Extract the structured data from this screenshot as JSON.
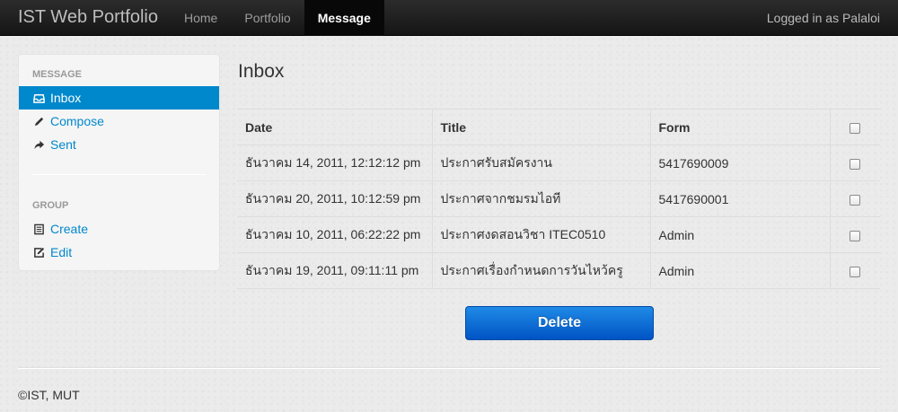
{
  "navbar": {
    "brand": "IST Web Portfolio",
    "items": [
      {
        "label": "Home",
        "active": false
      },
      {
        "label": "Portfolio",
        "active": false
      },
      {
        "label": "Message",
        "active": true
      }
    ],
    "user_text": "Logged in as Palaloi"
  },
  "sidebar": {
    "message_header": "MESSAGE",
    "message_items": [
      {
        "label": "Inbox",
        "icon": "inbox-icon",
        "active": true
      },
      {
        "label": "Compose",
        "icon": "pencil-icon",
        "active": false
      },
      {
        "label": "Sent",
        "icon": "share-arrow-icon",
        "active": false
      }
    ],
    "group_header": "GROUP",
    "group_items": [
      {
        "label": "Create",
        "icon": "list-icon"
      },
      {
        "label": "Edit",
        "icon": "edit-icon"
      }
    ]
  },
  "main": {
    "title": "Inbox",
    "columns": [
      "Date",
      "Title",
      "Form"
    ],
    "rows": [
      {
        "date": "ธันวาคม 14, 2011, 12:12:12 pm",
        "title": "ประกาศรับสมัครงาน",
        "form": "5417690009"
      },
      {
        "date": "ธันวาคม 20, 2011, 10:12:59 pm",
        "title": "ประกาศจากชมรมไอที",
        "form": "5417690001"
      },
      {
        "date": "ธันวาคม 10, 2011, 06:22:22 pm",
        "title": "ประกาศงดสอนวิชา ITEC0510",
        "form": "Admin"
      },
      {
        "date": "ธันวาคม 19, 2011, 09:11:11 pm",
        "title": "ประกาศเรื่องกำหนดการวันไหว้ครู",
        "form": "Admin"
      }
    ],
    "delete_label": "Delete"
  },
  "footer": {
    "text": "©IST, MUT"
  },
  "colors": {
    "accent": "#0088cc",
    "navbar": "#1b1b1b",
    "button": "#0a6fd6"
  }
}
